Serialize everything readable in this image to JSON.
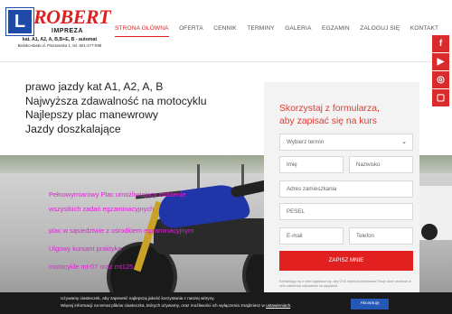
{
  "logo": {
    "badge": "L",
    "name": "ROBERT",
    "subtitle": "IMPREZA",
    "categories": "kat. A1, A2, A, B,B+E, B - automat",
    "address": "Bielsko-Biała ul. Piastowska 1, tel. 601-477-598"
  },
  "nav": {
    "items": [
      "STRONA GŁÓWNA",
      "OFERTA",
      "CENNIK",
      "TERMINY",
      "GALERIA",
      "EGZAMIN",
      "ZALOGUJ SIĘ",
      "KONTAKT"
    ]
  },
  "social": {
    "facebook": "f",
    "youtube": "▶",
    "instagram": "◎",
    "bottom": "▢"
  },
  "intro": {
    "lines": [
      "prawo jazdy kat A1, A2, A, B",
      "Najwyższa zdawalność na motocyklu",
      "Najlepszy plac manewrowy",
      "Jazdy doszkalające"
    ]
  },
  "photo_text": {
    "line1": "Pełnowymiarowy Plac umożliwiający zrobienie",
    "line2": "wszystkich zadań egzaminacyjnych",
    "line3": "plac w sąsiedztwie z ośrodkiem egzaminacyjnym",
    "line4": "Ulgowy kursant praktyka",
    "line5": "motocykle mt-07 oraz mt125"
  },
  "form": {
    "title_line1": "Skorzystaj z formularza,",
    "title_line2": "aby zapisać się na kurs",
    "select_placeholder": "Wybierz termin",
    "first_name": "Imię",
    "last_name": "Nazwisko",
    "address": "Adres zamieszkania",
    "pesel": "PESEL",
    "email": "E-mail",
    "phone": "Telefon",
    "submit": "ZAPISZ MNIE",
    "fine_print": "Kontaktując się z nami zgadzasz się, aby OSK Impreza przetwarzał Twoje dane osobowe w celu udzielenia odpowiedzi na zapytanie."
  },
  "cookie": {
    "line1": "Używamy ciasteczek, aby zapewnić najlepszą jakość korzystania z naszej witryny.",
    "line2_prefix": "Więcej informacji na temat plików ciasteczka, których używamy, oraz możliwości ich wyłączenia znajdziesz w",
    "link": "ustawieniach",
    "accept": "Akceptuję"
  },
  "colors": {
    "accent": "#e02020",
    "brand_blue": "#1f4aa8",
    "pink": "#e21fd8",
    "cookie_bg": "#1a1a1a",
    "accept_blue": "#2557b6"
  }
}
